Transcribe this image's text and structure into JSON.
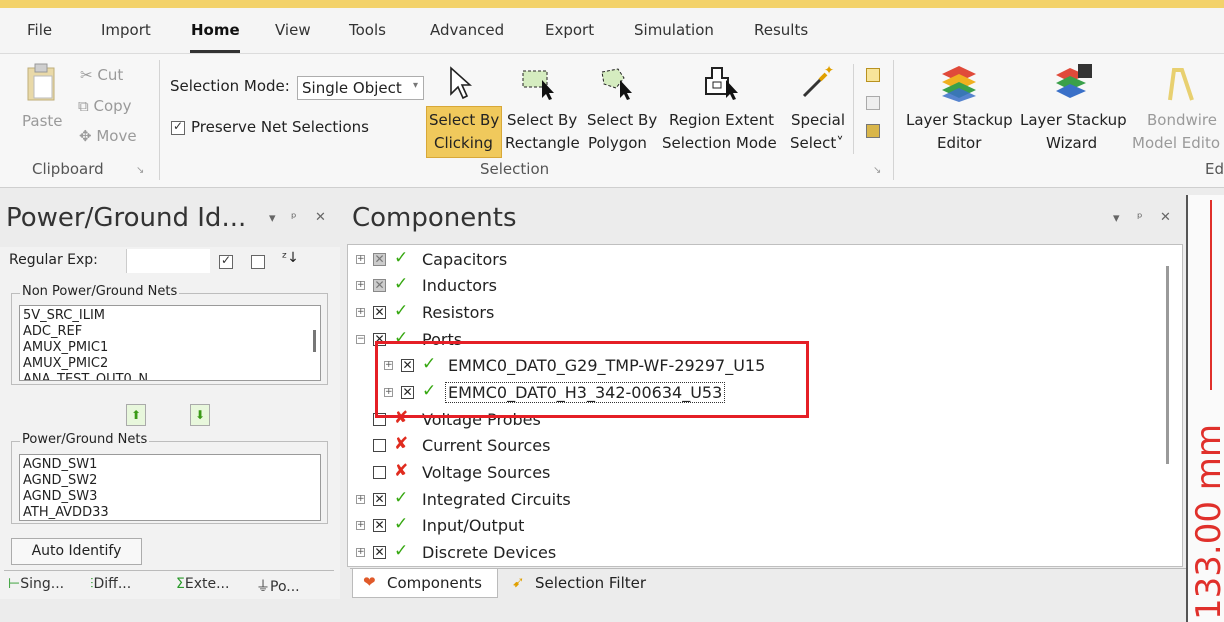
{
  "menu": [
    "File",
    "Import",
    "Home",
    "View",
    "Tools",
    "Advanced",
    "Export",
    "Simulation",
    "Results"
  ],
  "clipboard": {
    "paste": "Paste",
    "cut": "Cut",
    "copy": "Copy",
    "move": "Move",
    "group": "Clipboard"
  },
  "selection": {
    "mode_label": "Selection Mode:",
    "mode_value": "Single Object",
    "preserve": "Preserve Net Selections",
    "buttons": [
      {
        "l1": "Select By",
        "l2": "Clicking"
      },
      {
        "l1": "Select By",
        "l2": "Rectangle"
      },
      {
        "l1": "Select By",
        "l2": "Polygon"
      },
      {
        "l1": "Region Extent",
        "l2": "Selection Mode"
      },
      {
        "l1": "Special",
        "l2": "Select˅"
      }
    ],
    "group": "Selection"
  },
  "edit": {
    "buttons": [
      {
        "l1": "Layer Stackup",
        "l2": "Editor"
      },
      {
        "l1": "Layer Stackup",
        "l2": "Wizard"
      },
      {
        "l1": "Bondwire",
        "l2": "Model Edito"
      }
    ],
    "group": "Ed"
  },
  "left_panel": {
    "title": "Power/Ground Id...",
    "regexp_label": "Regular Exp:",
    "non_pg_label": "Non Power/Ground Nets",
    "non_pg_nets": [
      "5V_SRC_ILIM",
      "ADC_REF",
      "AMUX_PMIC1",
      "AMUX_PMIC2",
      "ANA_TEST_OUT0_N"
    ],
    "pg_label": "Power/Ground Nets",
    "pg_nets": [
      "AGND_SW1",
      "AGND_SW2",
      "AGND_SW3",
      "ATH_AVDD33"
    ],
    "auto_identify": "Auto Identify",
    "tabs": [
      "Sing...",
      "Diff...",
      "Exte...",
      "Po..."
    ]
  },
  "components": {
    "title": "Components",
    "tree": [
      {
        "label": "Capacitors",
        "state": "partial",
        "icon": "check"
      },
      {
        "label": "Inductors",
        "state": "partial",
        "icon": "check"
      },
      {
        "label": "Resistors",
        "state": "checked",
        "icon": "check"
      },
      {
        "label": "Ports",
        "state": "checked",
        "icon": "check"
      },
      {
        "label": "EMMC0_DAT0_G29_TMP-WF-29297_U15",
        "state": "checked",
        "icon": "check"
      },
      {
        "label": "EMMC0_DAT0_H3_342-00634_U53",
        "state": "checked",
        "icon": "check"
      },
      {
        "label": "Voltage Probes",
        "state": "unchecked",
        "icon": "x"
      },
      {
        "label": "Current Sources",
        "state": "unchecked",
        "icon": "x"
      },
      {
        "label": "Voltage Sources",
        "state": "unchecked",
        "icon": "x"
      },
      {
        "label": "Integrated Circuits",
        "state": "checked",
        "icon": "check"
      },
      {
        "label": "Input/Output",
        "state": "checked",
        "icon": "check"
      },
      {
        "label": "Discrete Devices",
        "state": "checked",
        "icon": "check"
      }
    ],
    "tabs": [
      "Components",
      "Selection Filter"
    ]
  },
  "ruler": {
    "value": "133.00 mm"
  },
  "colors": {
    "accent": "#f3d26a",
    "highlight": "#f0c95c",
    "red": "#e51f26",
    "green": "#37a812"
  }
}
